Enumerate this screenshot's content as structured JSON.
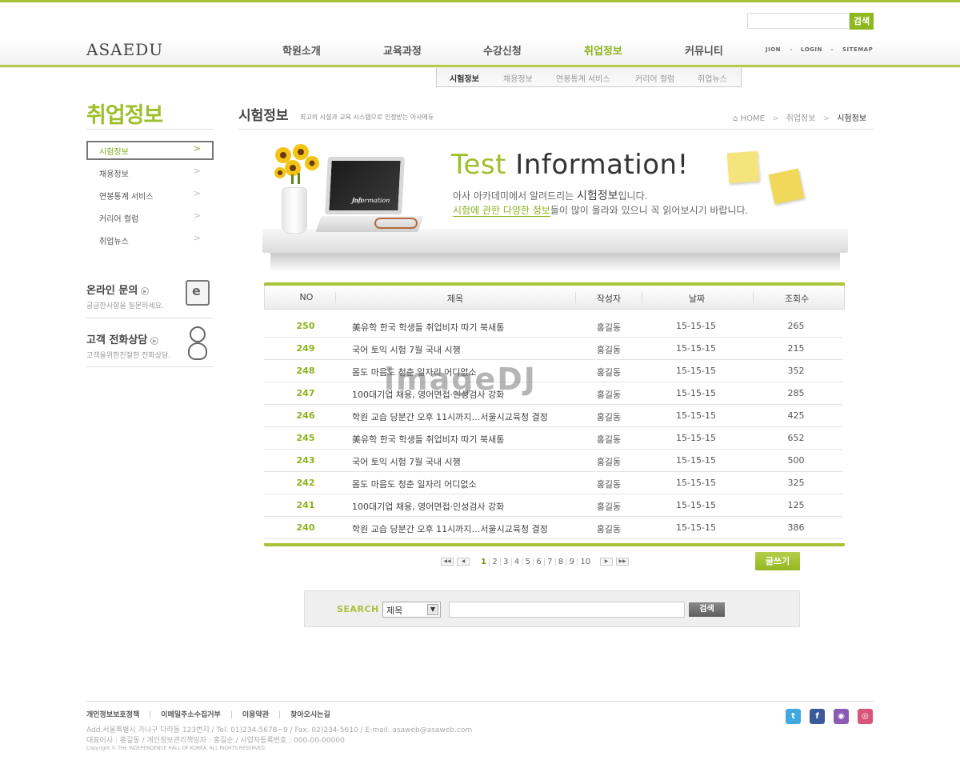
{
  "header": {
    "logo": "ASAEDU",
    "search_button": "검색",
    "gnb": [
      {
        "label": "학원소개"
      },
      {
        "label": "교육과정"
      },
      {
        "label": "수강신청"
      },
      {
        "label": "취업정보",
        "active": true
      },
      {
        "label": "커뮤니티"
      }
    ],
    "util": [
      "JION",
      "LOGIN",
      "SITEMAP"
    ],
    "subnav": [
      {
        "label": "시험정보",
        "active": true
      },
      {
        "label": "채용정보"
      },
      {
        "label": "연봉통계 서비스"
      },
      {
        "label": "커리어 컬럼"
      },
      {
        "label": "취업뉴스"
      }
    ],
    "accent_color": "#a8c23a"
  },
  "sidebar": {
    "title": "취업정보",
    "items": [
      {
        "label": "시험정보",
        "active": true
      },
      {
        "label": "채용정보"
      },
      {
        "label": "연봉통계 서비스"
      },
      {
        "label": "커리어 컬럼"
      },
      {
        "label": "취업뉴스"
      }
    ],
    "arrow": ">",
    "cs": [
      {
        "title": "온라인 문의",
        "sub": "궁금한사항을 질문하세요.",
        "icon": "e"
      },
      {
        "title": "고객 전화상담",
        "sub": "고객을위한친절한 전화상담."
      }
    ]
  },
  "main": {
    "title": "시험정보",
    "desc": "최고의 시설과 교육 시스템으로 인정받는 아사에듀",
    "breadcrumb": {
      "home": "HOME",
      "sep": ">",
      "section": "취업정보",
      "current": "시험정보"
    },
    "banner": {
      "screen_line1": "Job",
      "screen_line2": "information",
      "heading_green": "Test",
      "heading_rest": " Information!",
      "line1_pre": "아사 아카데미에서 알려드리는 ",
      "line1_bold": "시험정보",
      "line1_post": "입니다.",
      "line2_hl": "시험에 관한 다양한 정보",
      "line2_post": "들이 많이 올라와 있으니 꼭 읽어보시기 바랍니다."
    },
    "table": {
      "columns": [
        "NO",
        "제목",
        "작성자",
        "날짜",
        "조회수"
      ],
      "rows": [
        {
          "no": "250",
          "title": "美유학 한국 학생들 취업비자 따기 북새통",
          "writer": "홍길동",
          "date": "15-15-15",
          "views": "265"
        },
        {
          "no": "249",
          "title": "국어 토익 시험 7월 국내 시행",
          "writer": "홍길동",
          "date": "15-15-15",
          "views": "215"
        },
        {
          "no": "248",
          "title": "몸도 마음도 청춘 일자리 어디없소",
          "writer": "홍길동",
          "date": "15-15-15",
          "views": "352"
        },
        {
          "no": "247",
          "title": "100대기업 채용, 영어면접·인성검사 강화",
          "writer": "홍길동",
          "date": "15-15-15",
          "views": "285"
        },
        {
          "no": "246",
          "title": "학원 교습 당분간 오후 11시까지…서울시교육청 결정",
          "writer": "홍길동",
          "date": "15-15-15",
          "views": "425"
        },
        {
          "no": "245",
          "title": "美유학 한국 학생들 취업비자 따기 북새통",
          "writer": "홍길동",
          "date": "15-15-15",
          "views": "652"
        },
        {
          "no": "243",
          "title": "국어 토익 시험 7월 국내 시행",
          "writer": "홍길동",
          "date": "15-15-15",
          "views": "500"
        },
        {
          "no": "242",
          "title": "몸도 마음도 청춘 일자리 어디없소",
          "writer": "홍길동",
          "date": "15-15-15",
          "views": "325"
        },
        {
          "no": "241",
          "title": "100대기업 채용, 영어면접·인성검사 강화",
          "writer": "홍길동",
          "date": "15-15-15",
          "views": "125"
        },
        {
          "no": "240",
          "title": "학원 교습 당분간 오후 11시까지…서울시교육청 결정",
          "writer": "홍길동",
          "date": "15-15-15",
          "views": "386"
        }
      ]
    },
    "pager": {
      "pages": [
        "1",
        "2",
        "3",
        "4",
        "5",
        "6",
        "7",
        "8",
        "9",
        "10"
      ],
      "current": "1",
      "first": "◀◀",
      "prev": "◀",
      "next": "▶",
      "last": "▶▶"
    },
    "write_button": "글쓰기",
    "search": {
      "label": "SEARCH",
      "selected": "제목",
      "caret": "▼",
      "button": "검색"
    }
  },
  "footer": {
    "links": [
      "개인정보보호정책",
      "이메일주소수집거부",
      "이용약관",
      "찾아오시는길"
    ],
    "addr1": "Add.서울특별시 가나구 다라동 123번지  / Tel. 01)234-5678~9  / Fax. 02)234-5610  / E-mail. asaweb@asaweb.com",
    "addr2": "대표이사 : 홍길동 / 개인정보관리책임자 : 홍길순 / 사업자등록번호 : 000-00-00000",
    "copyright": "Copyright © THE INDEPENDENCE HALL OF KOREA. ALL RIGHTS RESERVED.",
    "sns": [
      {
        "name": "twitter-icon",
        "glyph": "t",
        "color": "#3fa9e0"
      },
      {
        "name": "facebook-icon",
        "glyph": "f",
        "color": "#3b5a9a"
      },
      {
        "name": "blog-icon",
        "glyph": "◉",
        "color": "#8a5bb5"
      },
      {
        "name": "instagram-icon",
        "glyph": "◎",
        "color": "#d9547a"
      }
    ]
  },
  "watermark": "imageDJ"
}
